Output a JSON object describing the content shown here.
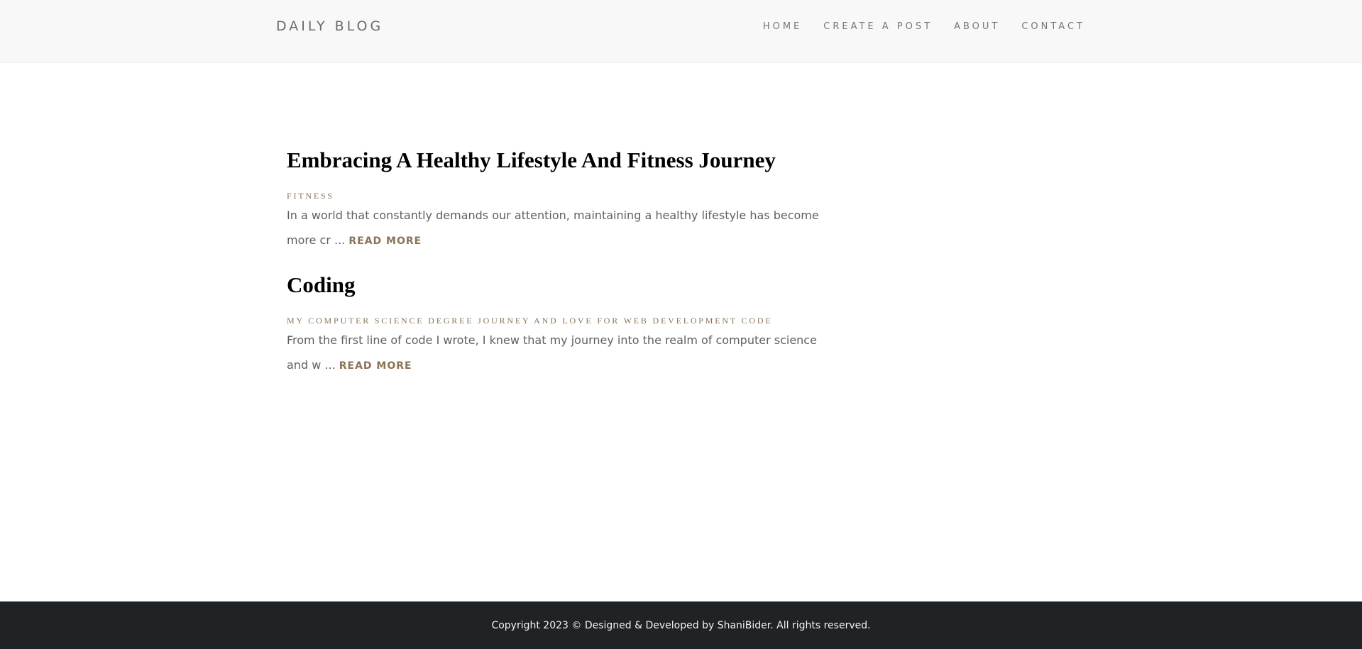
{
  "navbar": {
    "brand": "DAILY BLOG",
    "links": [
      {
        "label": "HOME"
      },
      {
        "label": "CREATE A POST"
      },
      {
        "label": "ABOUT"
      },
      {
        "label": "CONTACT"
      }
    ]
  },
  "posts": [
    {
      "title": "Embracing A Healthy Lifestyle And Fitness Journey",
      "category": "FITNESS",
      "excerpt": "In a world that constantly demands our attention, maintaining a healthy lifestyle has become more cr ...",
      "read_more": "READ MORE"
    },
    {
      "title": "Coding",
      "category": "MY COMPUTER SCIENCE DEGREE JOURNEY AND LOVE FOR WEB DEVELOPMENT CODE",
      "excerpt": "From the first line of code I wrote, I knew that my journey into the realm of computer science and w ...",
      "read_more": "READ MORE"
    }
  ],
  "footer": {
    "text": "Copyright 2023 © Designed & Developed by ShaniBider. All rights reserved."
  },
  "colors": {
    "navbar_bg": "#f8f8f8",
    "accent": "#8a7357",
    "footer_bg": "#1f2326"
  }
}
